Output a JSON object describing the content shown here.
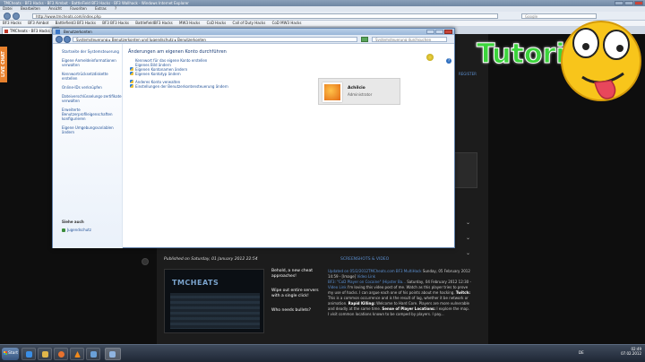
{
  "browser": {
    "title": "TMCheats - BF3 Hacks - BF3 Aimbot - BattleField BF3 Hacks - BF3 Wallhack - Windows Internet Explorer",
    "menu": [
      "Datei",
      "Bearbeiten",
      "Ansicht",
      "Favoriten",
      "Extras",
      "?"
    ],
    "address": "http://www.tmcheats.com/index.php",
    "search_placeholder": "Google",
    "bookmarks": [
      "BF3 Hacks",
      "BF3 Aimbot",
      "Battlefield3 BF3 Hacks",
      "BF3 BF3 Hacks",
      "BattlefieldBF3 Hacks",
      "MW3 Hacks",
      "CoD Hacks",
      "Call of Duty Hacks",
      "CoD MW3 Hacks"
    ],
    "tab_label": "TMCheats - BF3 Hacks - BF"
  },
  "site": {
    "live_chat": "LIVE CHAT",
    "register": "REGISTER",
    "published": "Published on Saturday, 01 January 2012 22:54",
    "screenshots_label": "SCREENSHOTS & VIDEO",
    "news_logo": "TMCHEATS",
    "headlines": [
      "Behold, a new cheat approaches!",
      "Wipe out entire servers with a single click!",
      "Who needs bullets?"
    ],
    "feed": {
      "line1_link": "Updated on 05/2/2012TMCheats.com BF3 MultiHack",
      "line1_text": "Sunday, 05 February 2012 14:59 - [Image]",
      "line1_video": "Video Link",
      "line2_link": "BF3: \"CoD Player on Cocaine\" (Hipster Ba...",
      "line2_text": "Saturday, 04 February 2012 12:30 -",
      "line2_video": "Video Link",
      "line3": "I'm loving this video post of me. Watch as this player tries to prove my use of hacks. I can argue each one of his points about me hacking.",
      "twitch": "Twitch:",
      "line4": "This is a common occurrence and is the result of lag, whether it be network or animation.",
      "rapid": "Rapid Killing:",
      "line5": "Welcome to Hard Core. Players are more vulnerable and deadly at the same time.",
      "sense": "Sense of Player Locations:",
      "line6": "I explore the map. I visit common locations known to be camped by players. I pay..."
    }
  },
  "control_panel": {
    "title": "Benutzerkonten",
    "path": "Systemsteuerung  ▸  Benutzerkonten und Jugendschutz  ▸  Benutzerkonten",
    "search_placeholder": "Systemsteuerung durchsuchen",
    "left_links": [
      "Startseite der Systemsteuerung",
      "Eigene Anmeldeinformationen verwalten",
      "Kennwortrücksetzdiskette erstellen",
      "Online-IDs verknüpfen",
      "Dateiverschlüsselungs-zertifikate verwalten",
      "Erweiterte Benutzerprofileigenschaften konfigurieren",
      "Eigene Umgebungsvariablen ändern"
    ],
    "see_also": "Siehe auch",
    "jugendschutz": "Jugendschutz",
    "heading": "Änderungen am eigenen Konto durchführen",
    "items_a": [
      "Kennwort für das eigene Konto erstellen",
      "Eigenes Bild ändern",
      "Eigenen Kontonamen ändern",
      "Eigenen Kontotyp ändern"
    ],
    "items_b": [
      "Anderes Konto verwalten",
      "Einstellungen der Benutzerkontensteuerung ändern"
    ],
    "account_name": "Achilcio",
    "account_role": "Administrator",
    "help": "?"
  },
  "overlay": {
    "tutorial": "Tutorial"
  },
  "taskbar": {
    "start": "Start",
    "lang": "DE",
    "time": "02:49",
    "date": "07.02.2012"
  },
  "colors": {
    "accent_link": "#1f4f96",
    "tutorial_green": "#3cd43c",
    "live_chat_orange": "#e8812d"
  }
}
